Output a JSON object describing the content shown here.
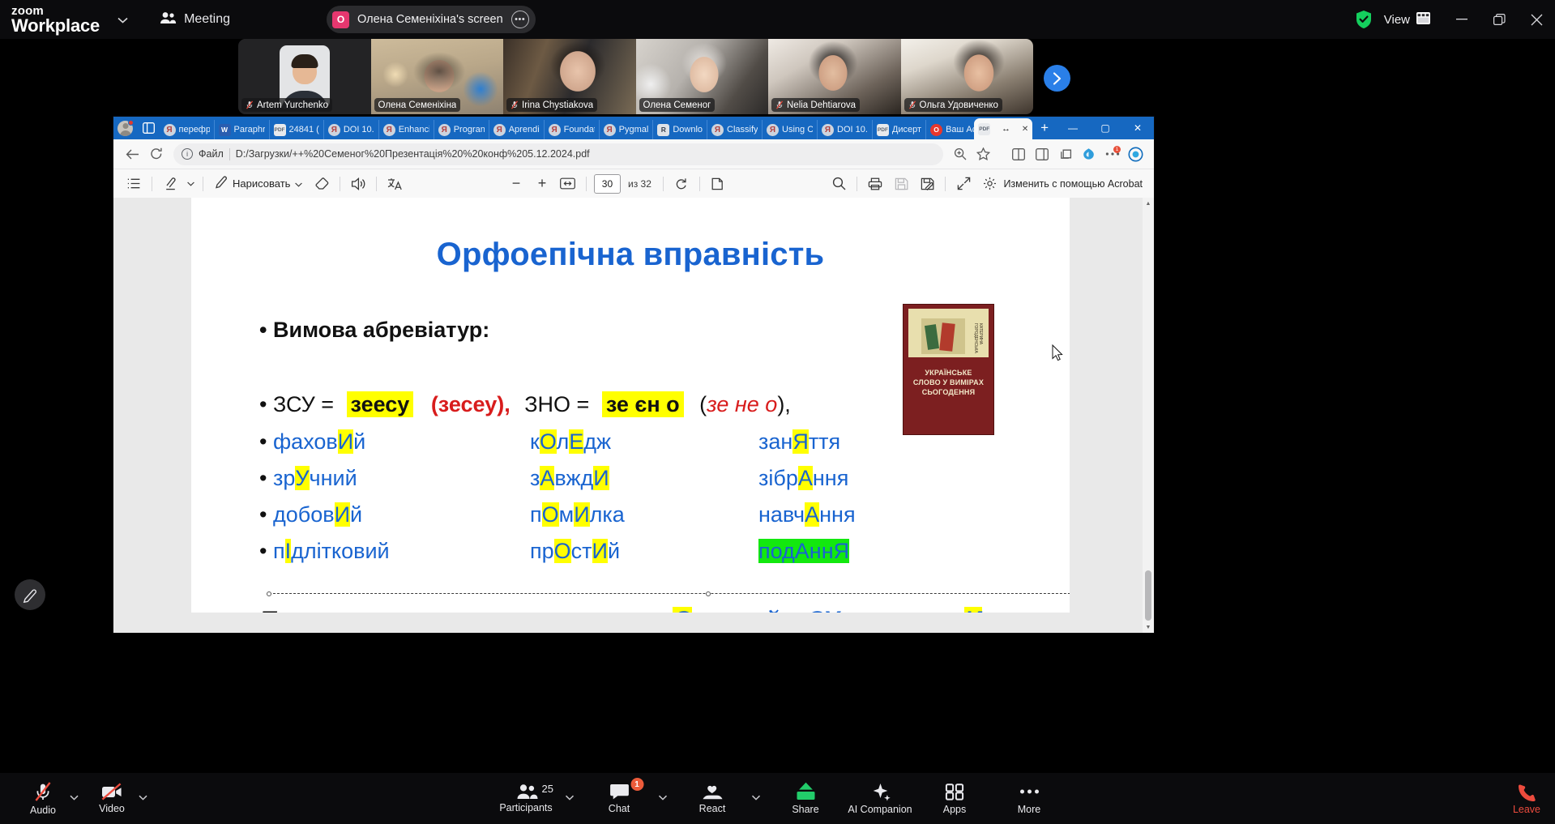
{
  "zoom_top": {
    "brand_line1": "zoom",
    "brand_line2": "Workplace",
    "meeting_label": "Meeting",
    "sharing_banner": {
      "avatar_initial": "О",
      "text": "Олена Семеніхіна's screen",
      "more_icon": "ellipsis-icon"
    },
    "shield_icon": "green-shield-check-icon",
    "view_label": "View",
    "view_icon": "grid-layout-icon",
    "window_minimize": "—",
    "window_restore": "❐",
    "window_close": "✕"
  },
  "filmstrip": {
    "next_arrow": "›",
    "participants": [
      {
        "name": "Artem Yurchenko",
        "muted": true,
        "active": false
      },
      {
        "name": "Олена Семеніхіна",
        "muted": false,
        "active": false
      },
      {
        "name": "Irina Chystiakova",
        "muted": true,
        "active": false
      },
      {
        "name": "Олена Семеног",
        "muted": false,
        "active": true
      },
      {
        "name": "Nelia Dehtiarova",
        "muted": true,
        "active": false
      },
      {
        "name": "Ольга Удовиченко",
        "muted": true,
        "active": false
      }
    ]
  },
  "browser": {
    "tabs": [
      {
        "label": "перефр",
        "icon": "yandex-icon"
      },
      {
        "label": "Paraphr",
        "icon": "wordtune-icon"
      },
      {
        "label": "24841 (",
        "icon": "pdf-icon"
      },
      {
        "label": "DOI 10.",
        "icon": "yandex-icon"
      },
      {
        "label": "Enhanci",
        "icon": "yandex-icon"
      },
      {
        "label": "Progran",
        "icon": "yandex-icon"
      },
      {
        "label": "Aprendi",
        "icon": "yandex-icon"
      },
      {
        "label": "Foundat",
        "icon": "yandex-icon"
      },
      {
        "label": "Pygmal",
        "icon": "yandex-icon"
      },
      {
        "label": "Downlo",
        "icon": "researchgate-icon"
      },
      {
        "label": "Classify",
        "icon": "yandex-icon"
      },
      {
        "label": "Using C",
        "icon": "yandex-icon"
      },
      {
        "label": "DOI 10.",
        "icon": "yandex-icon"
      },
      {
        "label": "Дисерт",
        "icon": "pdf-icon"
      },
      {
        "label": "Ваш Ac",
        "icon": "opera-icon"
      }
    ],
    "active_tab": {
      "label": "↔",
      "icon": "pdf-icon",
      "close": "✕"
    },
    "new_tab": "+",
    "window_controls": {
      "minimize": "—",
      "maximize": "▢",
      "close": "✕"
    },
    "address": {
      "info_icon": "info-circle-icon",
      "scheme_label": "Файл",
      "url": "D:/Загрузки/++%20Семеног%20Презентація%20%20конф%205.12.2024.pdf"
    },
    "address_icons": [
      "zoom-page-icon",
      "favorite-star-icon",
      "split-screen-icon",
      "reading-list-icon",
      "collections-icon",
      "browser-essentials-icon",
      "settings-more-icon",
      "copilot-icon"
    ],
    "address_badge": "1"
  },
  "pdf_toolbar": {
    "toc_icon": "table-of-contents-icon",
    "highlight_icon": "highlighter-icon",
    "highlight_caret": "⌄",
    "draw_label": "Нарисовать",
    "draw_caret": "⌄",
    "erase_icon": "eraser-icon",
    "read_aloud_icon": "read-aloud-icon",
    "translate_icon": "translate-icon",
    "zoom_out": "−",
    "zoom_in": "+",
    "fit_page_icon": "fit-to-width-icon",
    "page_current": "30",
    "page_total_label": "из 32",
    "rotate_icon": "rotate-icon",
    "layout_icon": "page-layout-icon",
    "search_icon": "search-icon",
    "print_icon": "print-icon",
    "save_icon": "save-icon",
    "save_as_icon": "save-as-icon",
    "fullscreen_icon": "fullscreen-icon",
    "settings_icon": "gear-icon",
    "acrobat_label": "Изменить с помощью Acrobat"
  },
  "slide": {
    "title": "Орфоепічна вправність",
    "subtitle_bullet": "Вимова абревіатур:",
    "abbrev_row": {
      "item1_label": "ЗСУ =",
      "item1_hl": "зеесу",
      "item1_paren": "(зесеу),",
      "item2_label": "ЗНО =",
      "item2_hl": "зе єн о",
      "item2_paren_open": "(",
      "item2_italic": "зе не о",
      "item2_paren_close": "),"
    },
    "word_rows": [
      {
        "c1": [
          "фахов",
          "И",
          "й"
        ],
        "c2": [
          "к",
          "О",
          "л",
          "Е",
          "дж"
        ],
        "c3": [
          "зан",
          "Я",
          "ття"
        ]
      },
      {
        "c1": [
          "зр",
          "У",
          "чний"
        ],
        "c2": [
          "з",
          "А",
          "вжд",
          "И",
          ""
        ],
        "c3": [
          "зібр",
          "А",
          "ння"
        ]
      },
      {
        "c1": [
          "добов",
          "И",
          "й"
        ],
        "c2": [
          "п",
          "О",
          "м",
          "И",
          "лка"
        ],
        "c3": [
          "навч",
          "А",
          "ння"
        ]
      },
      {
        "c1": [
          "п",
          "І",
          "длітковий"
        ],
        "c2": [
          "пр",
          "О",
          "ст",
          "И",
          "й"
        ],
        "c3_green": "подАннЯ"
      }
    ],
    "bottom_line": "Правильне   наголошування:   рукописний,   СУмщина,   вИписка,   завдАння",
    "book_cover": {
      "author": "КАТЕРИНА ГОРОДЕНСЬКА",
      "title_line1": "УКРАЇНСЬКЕ",
      "title_line2": "СЛОВО У ВИМІРАХ",
      "title_line3": "СЬОГОДЕННЯ"
    }
  },
  "zoom_bottom": {
    "items": [
      {
        "name": "Audio",
        "label": "Audio",
        "icon": "microphone-muted-icon",
        "caret": true
      },
      {
        "name": "Video",
        "label": "Video",
        "icon": "camera-muted-icon",
        "caret": true
      },
      {
        "name": "Participants",
        "label": "Participants",
        "icon": "people-icon",
        "count": "25",
        "caret": true
      },
      {
        "name": "Chat",
        "label": "Chat",
        "icon": "chat-bubble-icon",
        "badge": "1",
        "caret": true
      },
      {
        "name": "React",
        "label": "React",
        "icon": "heart-hand-icon",
        "caret": true
      },
      {
        "name": "Share",
        "label": "Share",
        "icon": "share-screen-icon",
        "caret": false
      },
      {
        "name": "AI Companion",
        "label": "AI Companion",
        "icon": "sparkle-icon",
        "caret": false
      },
      {
        "name": "Apps",
        "label": "Apps",
        "icon": "apps-grid-icon",
        "caret": false
      },
      {
        "name": "More",
        "label": "More",
        "icon": "ellipsis-icon",
        "caret": false
      }
    ],
    "leave": {
      "label": "Leave",
      "icon": "leave-meeting-icon"
    }
  },
  "colors": {
    "accent_blue": "#1964d0",
    "highlight_yellow": "#ffff00",
    "highlight_green": "#13e80f",
    "red": "#d81c1c",
    "zoom_green": "#1ecb6b",
    "leave_red": "#ec4b3d"
  }
}
